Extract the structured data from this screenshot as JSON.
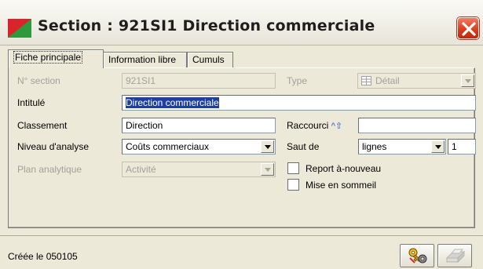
{
  "window": {
    "title": "Section : 921SI1 Direction commerciale"
  },
  "tabs": [
    {
      "label": "Fiche principale",
      "active": true
    },
    {
      "label": "Information libre",
      "active": false
    },
    {
      "label": "Cumuls",
      "active": false
    }
  ],
  "form": {
    "section": {
      "label": "N° section",
      "value": "921SI1",
      "disabled": true
    },
    "type": {
      "label": "Type",
      "value": "Détail",
      "disabled": true,
      "icon": "table-icon"
    },
    "intitule": {
      "label": "Intitulé",
      "value": "Direction commerciale",
      "selected": true
    },
    "classement": {
      "label": "Classement",
      "value": "Direction"
    },
    "raccourci": {
      "label": "Raccourci",
      "shortcut_symbol": "^⇧",
      "value": ""
    },
    "niveau": {
      "label": "Niveau d'analyse",
      "value": "Coûts commerciaux"
    },
    "saut": {
      "label": "Saut de",
      "value": "lignes",
      "count": "1"
    },
    "plan": {
      "label": "Plan analytique",
      "value": "Activité",
      "disabled": true
    },
    "report": {
      "label": "Report à-nouveau",
      "checked": false
    },
    "sommeil": {
      "label": "Mise en sommeil",
      "checked": false
    }
  },
  "status": {
    "created": "Créée le 050105"
  },
  "buttons": [
    {
      "name": "calculate-button",
      "icon": "key-gear-icon",
      "enabled": true
    },
    {
      "name": "print-button",
      "icon": "printer-icon",
      "enabled": false
    }
  ],
  "colors": {
    "background": "#ece9d8",
    "selection": "#1e3f9e",
    "close": "#d7391b"
  }
}
